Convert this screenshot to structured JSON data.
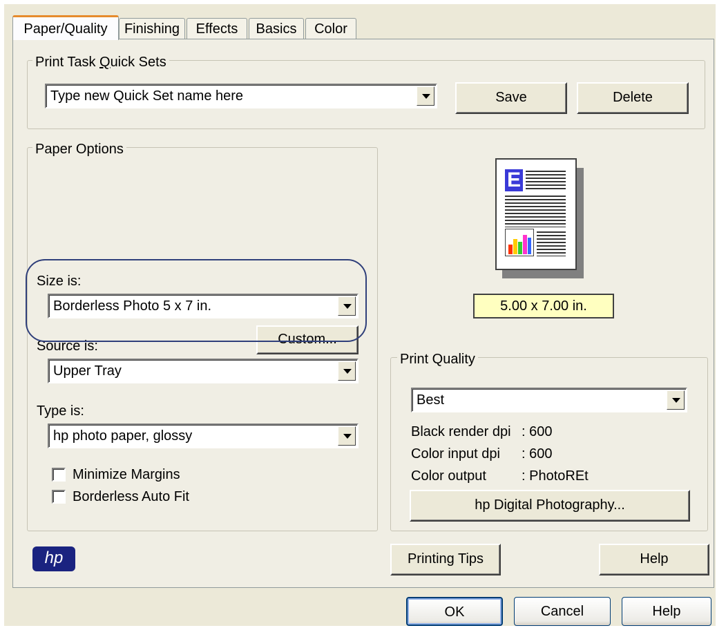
{
  "tabs": [
    "Paper/Quality",
    "Finishing",
    "Effects",
    "Basics",
    "Color"
  ],
  "quick_sets": {
    "title": "Print Task Quick Sets",
    "value": "Type new Quick Set name here",
    "save_label": "Save",
    "delete_label": "Delete"
  },
  "paper_options": {
    "title": "Paper Options",
    "size_label": "Size is:",
    "size_value": "Borderless Photo 5 x 7 in.",
    "custom_label": "Custom...",
    "source_label": "Source is:",
    "source_value": "Upper Tray",
    "type_label": "Type is:",
    "type_value": "hp photo paper, glossy",
    "minimize_margins_label": "Minimize Margins",
    "borderless_auto_fit_label": "Borderless Auto Fit"
  },
  "preview": {
    "dimensions": "5.00 x 7.00 in.",
    "page_letter": "E",
    "highlight_color": "#ffffc0"
  },
  "print_quality": {
    "title": "Print Quality",
    "value": "Best",
    "black_dpi_label": "Black render dpi",
    "black_dpi_value": ": 600",
    "color_dpi_label": "Color input dpi",
    "color_dpi_value": ": 600",
    "color_output_label": "Color output",
    "color_output_value": ": PhotoREt",
    "hp_digital_label": "hp Digital Photography..."
  },
  "footer": {
    "logo_text": "hp",
    "printing_tips_label": "Printing Tips",
    "help_label": "Help"
  },
  "dialog_buttons": {
    "ok": "OK",
    "cancel": "Cancel",
    "help": "Help"
  },
  "colors": {
    "dialog_bg": "#ece9d8",
    "hp_blue": "#1a2380",
    "annotation_ring": "#2f3f7a"
  }
}
